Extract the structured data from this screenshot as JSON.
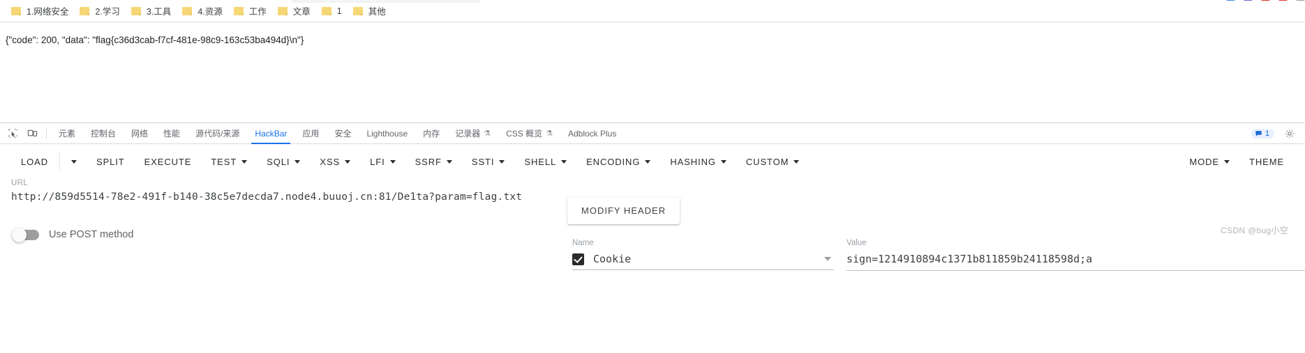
{
  "browser": {
    "bookmarks": [
      {
        "label": "1.网络安全",
        "icon": "folder-icon"
      },
      {
        "label": "2.学习",
        "icon": "folder-icon"
      },
      {
        "label": "3.工具",
        "icon": "folder-icon"
      },
      {
        "label": "4.资源",
        "icon": "folder-icon"
      },
      {
        "label": "工作",
        "icon": "folder-icon"
      },
      {
        "label": "文章",
        "icon": "folder-icon"
      },
      {
        "label": "1",
        "icon": "folder-icon"
      },
      {
        "label": "其他",
        "icon": "folder-icon"
      }
    ]
  },
  "page": {
    "response_text": "{\"code\": 200, \"data\": \"flag{c36d3cab-f7cf-481e-98c9-163c53ba494d}\\n\"}"
  },
  "devtools": {
    "icons": {
      "inspect": "inspect-element-icon",
      "device": "device-toolbar-icon",
      "settings": "gear-icon",
      "messages": "message-badge-icon"
    },
    "message_count": "1",
    "tabs": [
      {
        "label": "元素",
        "active": false,
        "beaker": ""
      },
      {
        "label": "控制台",
        "active": false,
        "beaker": ""
      },
      {
        "label": "网络",
        "active": false,
        "beaker": ""
      },
      {
        "label": "性能",
        "active": false,
        "beaker": ""
      },
      {
        "label": "源代码/来源",
        "active": false,
        "beaker": ""
      },
      {
        "label": "HackBar",
        "active": true,
        "beaker": ""
      },
      {
        "label": "应用",
        "active": false,
        "beaker": ""
      },
      {
        "label": "安全",
        "active": false,
        "beaker": ""
      },
      {
        "label": "Lighthouse",
        "active": false,
        "beaker": ""
      },
      {
        "label": "内存",
        "active": false,
        "beaker": ""
      },
      {
        "label": "记录器",
        "active": false,
        "beaker": "⚗"
      },
      {
        "label": "CSS 概览",
        "active": false,
        "beaker": "⚗"
      },
      {
        "label": "Adblock Plus",
        "active": false,
        "beaker": ""
      }
    ]
  },
  "hackbar": {
    "toolbar": [
      {
        "label": "LOAD",
        "caret": false
      },
      {
        "label": "",
        "caret": true
      },
      {
        "label": "SPLIT",
        "caret": false
      },
      {
        "label": "EXECUTE",
        "caret": false
      },
      {
        "label": "TEST",
        "caret": true
      },
      {
        "label": "SQLI",
        "caret": true
      },
      {
        "label": "XSS",
        "caret": true
      },
      {
        "label": "LFI",
        "caret": true
      },
      {
        "label": "SSRF",
        "caret": true
      },
      {
        "label": "SSTI",
        "caret": true
      },
      {
        "label": "SHELL",
        "caret": true
      },
      {
        "label": "ENCODING",
        "caret": true
      },
      {
        "label": "HASHING",
        "caret": true
      },
      {
        "label": "CUSTOM",
        "caret": true
      }
    ],
    "toolbar_right": [
      {
        "label": "MODE",
        "caret": true
      },
      {
        "label": "THEME",
        "caret": false
      }
    ],
    "url_label": "URL",
    "url_value": "http://859d5514-78e2-491f-b140-38c5e7decda7.node4.buuoj.cn:81/De1ta?param=flag.txt",
    "post_toggle_label": "Use POST method",
    "post_toggle_state": "off",
    "modify_header_label": "MODIFY HEADER",
    "header_name_label": "Name",
    "header_value_label": "Value",
    "header_rows": [
      {
        "checked": true,
        "name": "Cookie",
        "value": "sign=1214910894c1371b811859b24118598d;a"
      }
    ]
  },
  "watermark": "CSDN @bug小空"
}
